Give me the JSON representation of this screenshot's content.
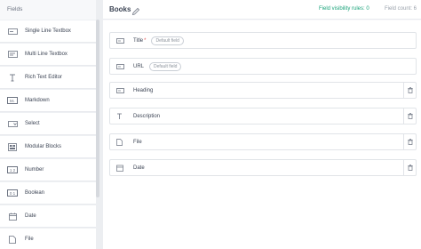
{
  "sidebar": {
    "header": "Fields",
    "items": [
      {
        "label": "Single Line Textbox",
        "icon": "textbox-icon"
      },
      {
        "label": "Multi Line Textbox",
        "icon": "multiline-icon"
      },
      {
        "label": "Rich Text Editor",
        "icon": "text-cursor-icon"
      },
      {
        "label": "Markdown",
        "icon": "markdown-icon"
      },
      {
        "label": "Select",
        "icon": "select-icon"
      },
      {
        "label": "Modular Blocks",
        "icon": "modular-blocks-icon"
      },
      {
        "label": "Number",
        "icon": "number-icon"
      },
      {
        "label": "Boolean",
        "icon": "boolean-icon"
      },
      {
        "label": "Date",
        "icon": "calendar-icon"
      },
      {
        "label": "File",
        "icon": "file-icon"
      }
    ],
    "icon_glyphs": {
      "markdown": "M↓",
      "number": "1 2",
      "boolean": "0 1"
    }
  },
  "header": {
    "title": "Books",
    "visibility_rules": "Field visibility rules: 0",
    "field_count": "Field count: 6"
  },
  "fields": [
    {
      "label": "Title",
      "required": "*",
      "pill": "Default field",
      "icon": "textbox-icon",
      "deletable": false
    },
    {
      "label": "URL",
      "pill": "Default field",
      "icon": "textbox-icon",
      "deletable": false
    },
    {
      "label": "Heading",
      "icon": "textbox-icon",
      "deletable": true
    },
    {
      "label": "Description",
      "icon": "text-cursor-icon",
      "deletable": true
    },
    {
      "label": "File",
      "icon": "file-icon",
      "deletable": true
    },
    {
      "label": "Date",
      "icon": "calendar-icon",
      "deletable": true
    }
  ],
  "colors": {
    "accent": "#1aa37a",
    "required": "#e35555",
    "border": "#e1e4e8"
  }
}
